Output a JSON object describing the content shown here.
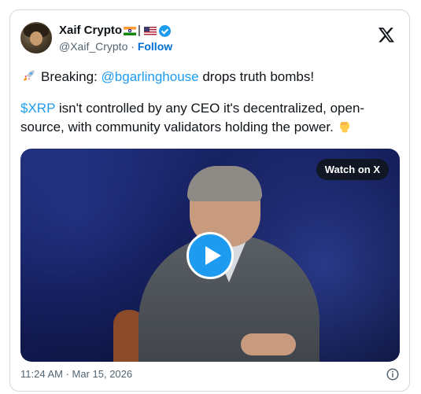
{
  "author": {
    "display_name": "Xaif Crypto",
    "name_separator": "|",
    "handle": "@Xaif_Crypto",
    "dot": "·",
    "follow_label": "Follow"
  },
  "tweet": {
    "line1_prefix": "Breaking: ",
    "mention": "@bgarlinghouse",
    "line1_suffix": " drops truth bombs!",
    "cashtag": "$XRP",
    "line2_text": " isn't controlled by any CEO it's decentralized, open-source, with community validators holding the power."
  },
  "media": {
    "watch_label": "Watch on X"
  },
  "footer": {
    "timestamp": "11:24 AM · Mar 15, 2026"
  },
  "colors": {
    "link": "#1d9bf0",
    "follow": "#006fd6",
    "verified": "#1d9bf0"
  },
  "icons": [
    "x-logo-icon",
    "verified-badge-icon",
    "rocket-icon",
    "raised-fist-icon",
    "play-icon",
    "info-icon"
  ]
}
